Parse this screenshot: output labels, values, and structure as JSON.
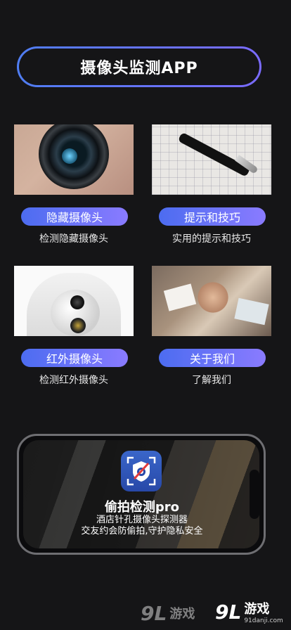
{
  "header": {
    "title": "摄像头监测APP"
  },
  "cards": [
    {
      "photo": "camera-lens-photo",
      "label": "隐藏摄像头",
      "desc": "检测隐藏摄像头"
    },
    {
      "photo": "fountain-pen-photo",
      "label": "提示和技巧",
      "desc": "实用的提示和技巧"
    },
    {
      "photo": "dome-camera-photo",
      "label": "红外摄像头",
      "desc": "检测红外摄像头"
    },
    {
      "photo": "team-hands-photo",
      "label": "关于我们",
      "desc": "了解我们"
    }
  ],
  "promo": {
    "app_name": "偷拍检测pro",
    "desc_line1": "酒店针孔摄像头探测器",
    "desc_line2": "交友约会防偷拍,守护隐私安全"
  },
  "watermark": {
    "logo": "9L",
    "name": "游戏",
    "url": "91danji.com"
  },
  "colors": {
    "accent_start": "#4c6cf0",
    "accent_end": "#8a7bff",
    "background": "#151517"
  }
}
